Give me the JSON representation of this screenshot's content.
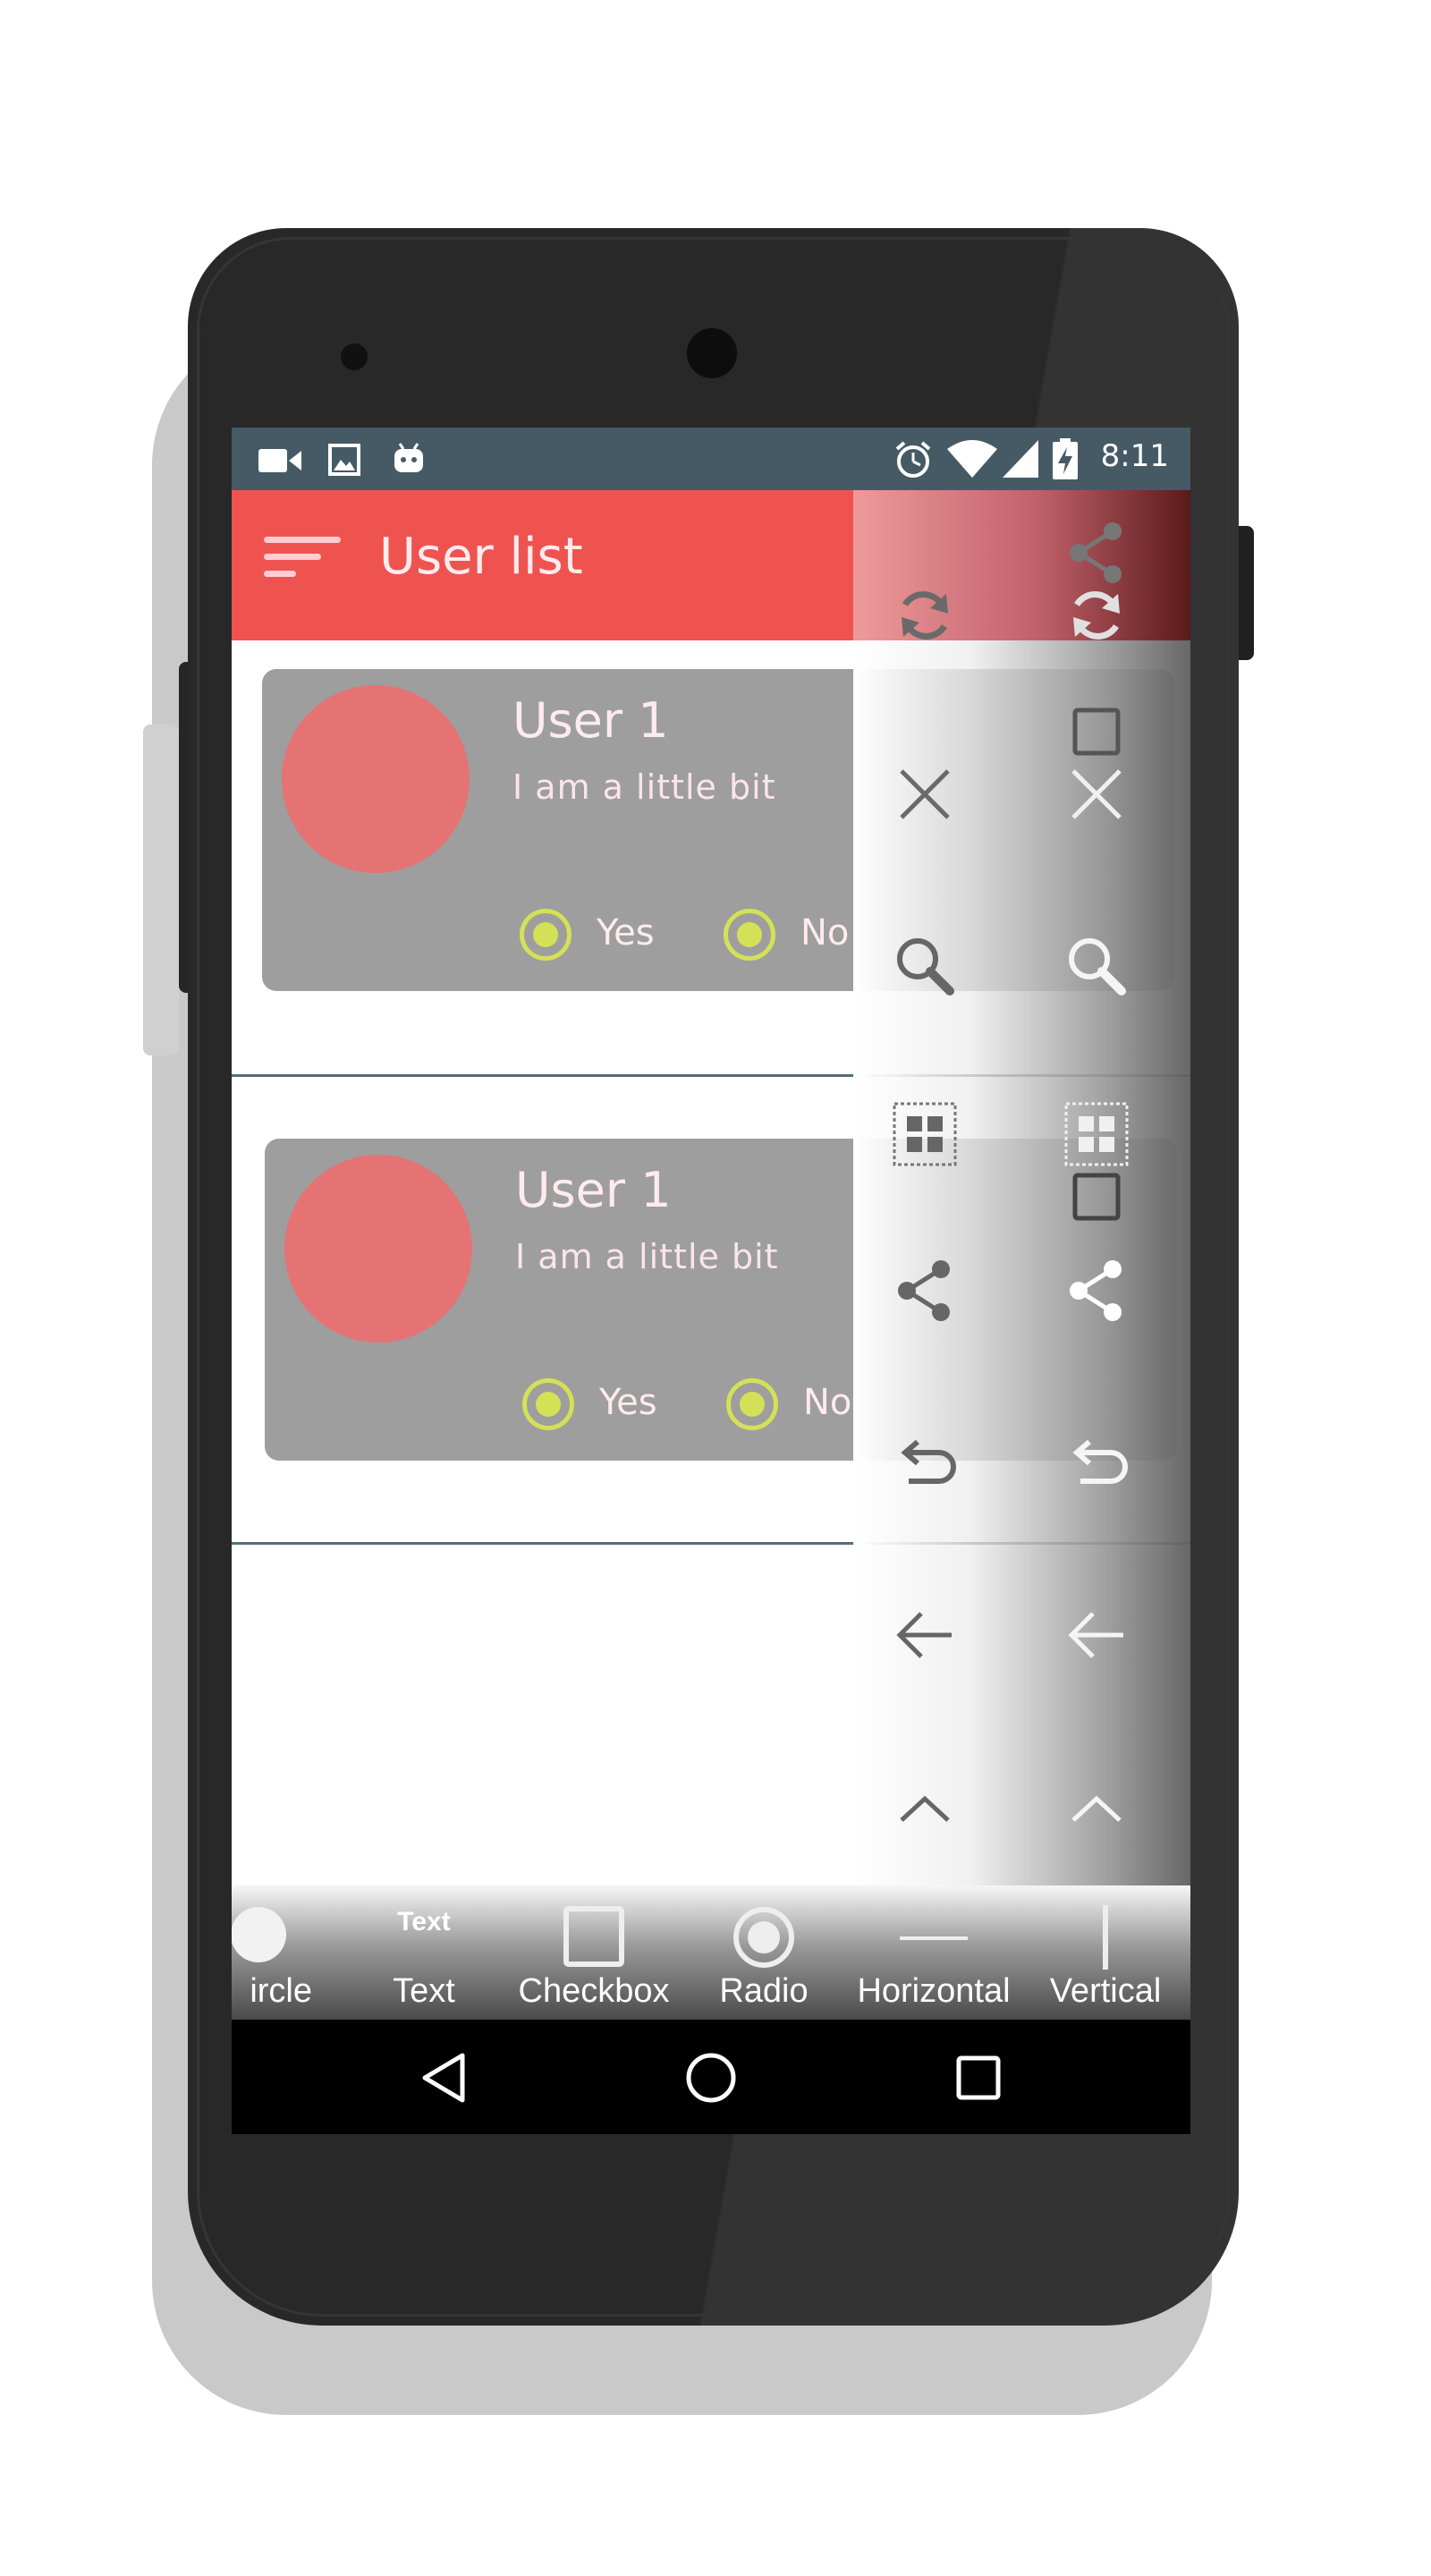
{
  "status_bar": {
    "time": "8:11",
    "left_icons": [
      "videocam-icon",
      "image-icon",
      "android-icon"
    ],
    "right_icons": [
      "alarm-icon",
      "wifi-icon",
      "cell-signal-icon",
      "battery-charging-icon"
    ]
  },
  "app_bar": {
    "title": "User list",
    "menu_icon": "sort-menu-icon",
    "color": "#ef5350"
  },
  "cards": [
    {
      "name": "User 1",
      "description": "I am a little bit",
      "option_yes": "Yes",
      "option_no": "No"
    },
    {
      "name": "User 1",
      "description": "I am a little bit",
      "option_yes": "Yes",
      "option_no": "No"
    }
  ],
  "icon_palette": {
    "icons": [
      "share-icon",
      "refresh-icon",
      "checkbox-outline-icon",
      "close-icon",
      "search-icon",
      "grid-view-icon",
      "checkbox-outline-icon",
      "share-icon",
      "undo-icon",
      "arrow-back-icon",
      "chevron-up-icon"
    ]
  },
  "widget_bar": {
    "items": [
      {
        "label": "ircle",
        "icon": "circle-icon"
      },
      {
        "label": "Text",
        "icon": "text-icon",
        "glyph_text": "Text"
      },
      {
        "label": "Checkbox",
        "icon": "checkbox-icon"
      },
      {
        "label": "Radio",
        "icon": "radio-icon"
      },
      {
        "label": "Horizontal",
        "icon": "horizontal-line-icon"
      },
      {
        "label": "Vertical",
        "icon": "vertical-line-icon"
      }
    ]
  },
  "nav_bar": {
    "buttons": [
      "back-triangle-icon",
      "home-circle-icon",
      "recents-square-icon"
    ]
  },
  "colors": {
    "status_bar": "#455a64",
    "card": "#9e9e9e",
    "avatar": "#e57373",
    "radio_accent": "#d4e157"
  }
}
